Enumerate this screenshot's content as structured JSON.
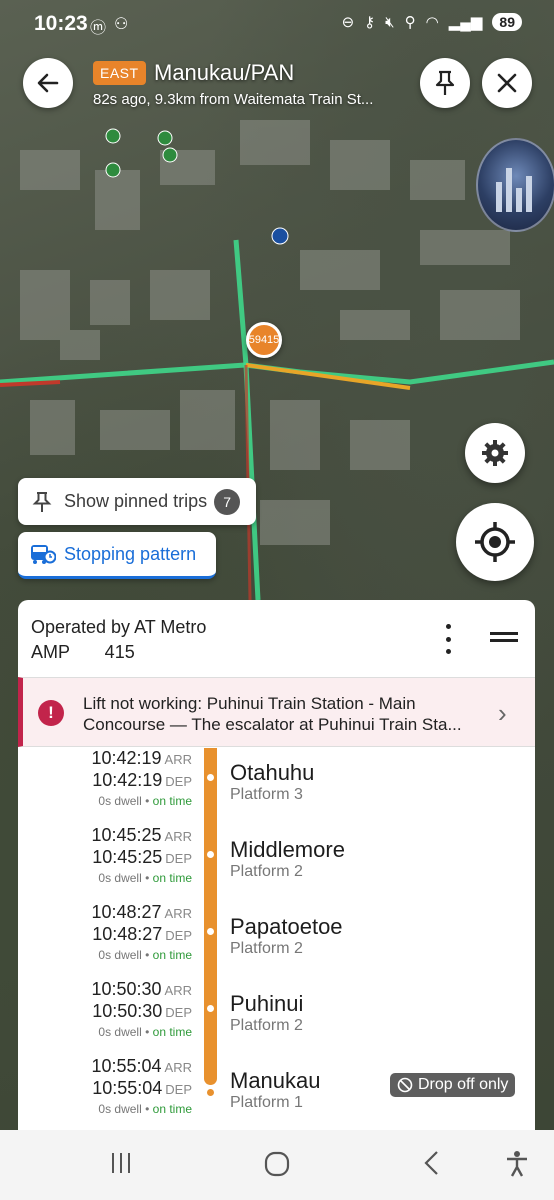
{
  "status_bar": {
    "time": "10:23",
    "battery": "89"
  },
  "header": {
    "direction_badge": "EAST",
    "title": "Manukau/PAN",
    "subtitle": "82s ago, 9.3km from Waitemata Train St..."
  },
  "map": {
    "vehicle_label": "59415"
  },
  "chips": {
    "pinned_label": "Show pinned trips",
    "pinned_count": "7",
    "stopping_label": "Stopping pattern"
  },
  "sheet": {
    "operator": "Operated by AT Metro",
    "route_code": "AMP 415"
  },
  "alert": {
    "text": "Lift not working: Puhinui Train Station - Main Concourse — The escalator at Puhinui Train Sta..."
  },
  "stops": [
    {
      "arr": "10:42:19",
      "arr_tag": "ARR",
      "dep": "10:42:19",
      "dep_tag": "DEP",
      "dwell": "0s dwell",
      "status": "on time",
      "name": "Otahuhu",
      "platform": "Platform 3"
    },
    {
      "arr": "10:45:25",
      "arr_tag": "ARR",
      "dep": "10:45:25",
      "dep_tag": "DEP",
      "dwell": "0s dwell",
      "status": "on time",
      "name": "Middlemore",
      "platform": "Platform 2"
    },
    {
      "arr": "10:48:27",
      "arr_tag": "ARR",
      "dep": "10:48:27",
      "dep_tag": "DEP",
      "dwell": "0s dwell",
      "status": "on time",
      "name": "Papatoetoe",
      "platform": "Platform 2"
    },
    {
      "arr": "10:50:30",
      "arr_tag": "ARR",
      "dep": "10:50:30",
      "dep_tag": "DEP",
      "dwell": "0s dwell",
      "status": "on time",
      "name": "Puhinui",
      "platform": "Platform 2"
    },
    {
      "arr": "10:55:04",
      "arr_tag": "ARR",
      "dep": "10:55:04",
      "dep_tag": "DEP",
      "dwell": "0s dwell",
      "status": "on time",
      "name": "Manukau",
      "platform": "Platform 1",
      "badge": "Drop off only"
    }
  ],
  "colors": {
    "accent_orange": "#e8912e",
    "alert_red": "#c2244b",
    "link_blue": "#1a6ed8",
    "on_time_green": "#2f9a3a"
  }
}
